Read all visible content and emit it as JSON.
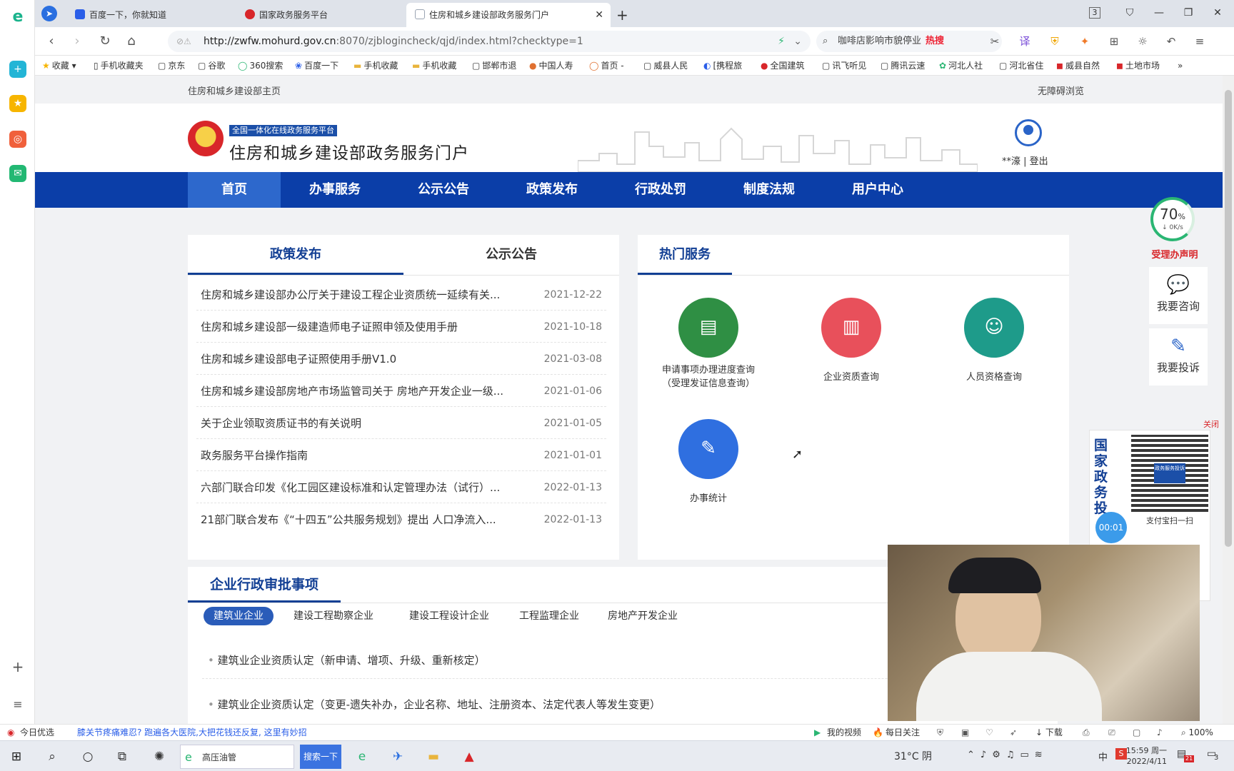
{
  "browser": {
    "tabs": [
      {
        "label": "百度一下，你就知道",
        "favicon_color": "#2a5ee8"
      },
      {
        "label": "国家政务服务平台",
        "favicon_color": "#d8262a"
      },
      {
        "label": "住房和城乡建设部政务服务门户",
        "favicon_color": "#9aa4b2"
      }
    ],
    "new_tab": "+",
    "tab_count_badge": "3",
    "url_host": "http://zwfw.mohurd.gov.cn",
    "url_rest": ":8070/zjblogincheck/qjd/index.html?checktype=1",
    "search_text": "咖啡店影响市貌停业",
    "search_hot": "热搜",
    "bookmarks": [
      "收藏",
      "手机收藏夹",
      "京东",
      "谷歌",
      "360搜索",
      "百度一下",
      "手机收藏",
      "手机收藏",
      "邯郸市退",
      "中国人寿",
      "首页 -",
      "威县人民",
      "[携程旅",
      "全国建筑",
      "讯飞听见",
      "腾讯云速",
      "河北人社",
      "河北省住",
      "威县自然",
      "土地市场",
      "»"
    ]
  },
  "page": {
    "top_link": "住房和城乡建设部主页",
    "accessibility": "无障碍浏览",
    "badge": "全国一体化在线政务服务平台",
    "site_title": "住房和城乡建设部政务服务门户",
    "user_masked": "**濠",
    "logout": "登出",
    "nav": [
      "首页",
      "办事服务",
      "公示公告",
      "政策发布",
      "行政处罚",
      "制度法规",
      "用户中心"
    ],
    "policy_tabs": [
      "政策发布",
      "公示公告"
    ],
    "news": [
      {
        "title": "住房和城乡建设部办公厅关于建设工程企业资质统一延续有关...",
        "date": "2021-12-22"
      },
      {
        "title": "住房和城乡建设部一级建造师电子证照申领及使用手册",
        "date": "2021-10-18"
      },
      {
        "title": "住房和城乡建设部电子证照使用手册V1.0",
        "date": "2021-03-08"
      },
      {
        "title": "住房和城乡建设部房地产市场监管司关于 房地产开发企业一级...",
        "date": "2021-01-06"
      },
      {
        "title": "关于企业领取资质证书的有关说明",
        "date": "2021-01-05"
      },
      {
        "title": "政务服务平台操作指南",
        "date": "2021-01-01"
      },
      {
        "title": "六部门联合印发《化工园区建设标准和认定管理办法（试行）...",
        "date": "2022-01-13"
      },
      {
        "title": "21部门联合发布《“十四五”公共服务规划》提出 人口净流入...",
        "date": "2022-01-13"
      }
    ],
    "hot_title": "热门服务",
    "services": [
      {
        "line1": "申请事项办理进度查询",
        "line2": "（受理发证信息查询）",
        "color": "#2f8f44",
        "icon": "card-reader-icon"
      },
      {
        "line1": "企业资质查询",
        "line2": "",
        "color": "#e8505b",
        "icon": "building-icon"
      },
      {
        "line1": "人员资格查询",
        "line2": "",
        "color": "#1e9b8a",
        "icon": "worker-icon"
      },
      {
        "line1": "办事统计",
        "line2": "",
        "color": "#2f6fe0",
        "icon": "tools-icon"
      }
    ],
    "approval_title": "企业行政审批事项",
    "approval_tabs": [
      "建筑业企业",
      "建设工程勘察企业",
      "建设工程设计企业",
      "工程监理企业",
      "房地产开发企业"
    ],
    "approval_items": [
      "建筑业企业资质认定（新申请、增项、升级、重新核定）",
      "建筑业企业资质认定（变更-遗失补办，企业名称、地址、注册资本、法定代表人等发生变更）"
    ],
    "float": {
      "speed_value": "70",
      "speed_unit": "%",
      "speed_rate": "0K/s",
      "statement": "受理办声明",
      "consult": "我要咨询",
      "complain": "我要投诉",
      "close": "关闭",
      "promo_text": "国家政务投",
      "qr_caption_top": "政务服务投诉",
      "qr_caption": "支付宝扫一扫",
      "timer": "00:01"
    }
  },
  "statusbar": {
    "today": "今日优选",
    "news": "膝关节疼痛难忍? 跑遍各大医院,大把花钱还反复, 这里有妙招",
    "videos": "我的视频",
    "daily": "每日关注",
    "download": "下载",
    "zoom": "100%"
  },
  "taskbar": {
    "app_label": "高压油管",
    "search_button": "搜索一下",
    "weather": "31°C 阴",
    "time": "15:59 周一",
    "date": "2022/4/11",
    "notif_count": "21",
    "notif_count2": "3"
  }
}
